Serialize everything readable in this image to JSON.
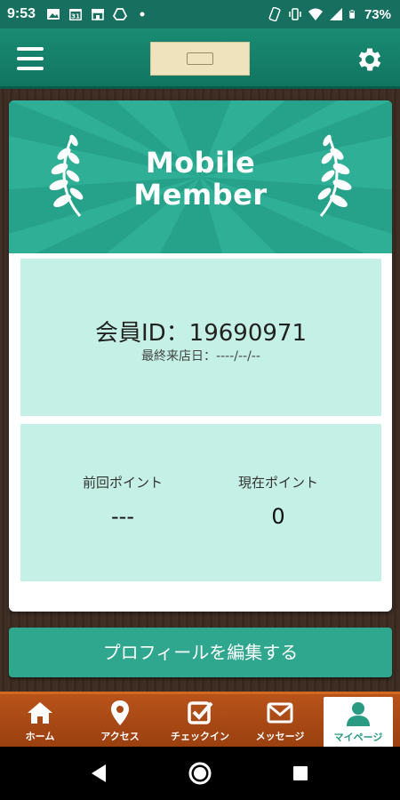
{
  "status_bar": {
    "time": "9:53",
    "battery": "73%",
    "icons": [
      "photo-icon",
      "calendar-icon",
      "store-icon",
      "drive-icon",
      "dot-icon",
      "phone-settings-icon",
      "vibrate-icon",
      "wifi-icon",
      "signal-icon",
      "battery-icon"
    ]
  },
  "header": {
    "menu_icon": "hamburger-icon",
    "settings_icon": "gear-icon",
    "logo": "brand-logo"
  },
  "card": {
    "banner_title_line1": "Mobile",
    "banner_title_line2": "Member",
    "member_id_label": "会員ID：",
    "member_id_value": "19690971",
    "last_visit_label": "最終来店日：",
    "last_visit_value": "----/--/--",
    "prev_points_label": "前回ポイント",
    "prev_points_value": "---",
    "curr_points_label": "現在ポイント",
    "curr_points_value": "0"
  },
  "actions": {
    "edit_profile_label": "プロフィールを編集する"
  },
  "bottom_nav": {
    "items": [
      {
        "label": "ホーム",
        "icon": "home-icon"
      },
      {
        "label": "アクセス",
        "icon": "map-pin-icon"
      },
      {
        "label": "チェックイン",
        "icon": "checkbox-icon"
      },
      {
        "label": "メッセージ",
        "icon": "mail-icon"
      },
      {
        "label": "マイページ",
        "icon": "person-icon"
      }
    ],
    "active": "マイページ"
  },
  "colors": {
    "primary": "#17705f",
    "banner": "#27a28a",
    "panel": "#c5f0e5",
    "button": "#2fa68e",
    "nav": "#b8531a"
  }
}
